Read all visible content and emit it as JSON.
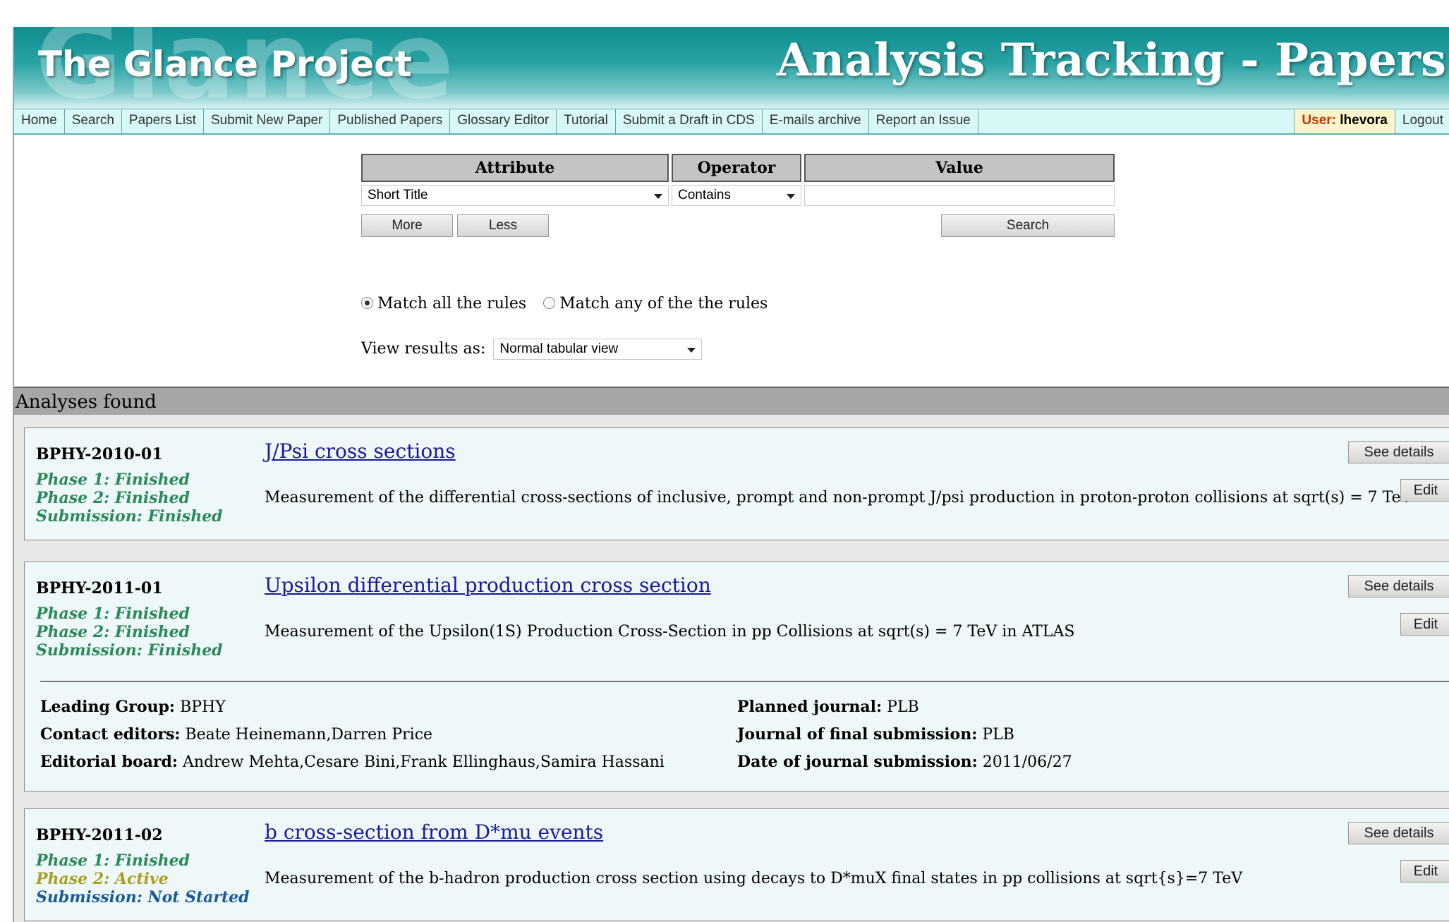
{
  "header": {
    "logo_watermark": "Glance",
    "logo": "The Glance Project",
    "title": "Analysis Tracking - Papers"
  },
  "nav": {
    "items": [
      "Home",
      "Search",
      "Papers List",
      "Submit New Paper",
      "Published Papers",
      "Glossary Editor",
      "Tutorial",
      "Submit a Draft in CDS",
      "E-mails archive",
      "Report an Issue"
    ],
    "user_label": "User:",
    "user_name": "lhevora",
    "logout": "Logout"
  },
  "search": {
    "headers": {
      "attribute": "Attribute",
      "operator": "Operator",
      "value": "Value"
    },
    "attribute_selected": "Short Title",
    "operator_selected": "Contains",
    "value": "",
    "more_label": "More",
    "less_label": "Less",
    "search_label": "Search",
    "match_all_label": "Match all the rules",
    "match_any_label": "Match any of the the rules",
    "match_selected": "all",
    "view_label": "View results as:",
    "view_selected": "Normal tabular view"
  },
  "results": {
    "heading": "Analyses found",
    "see_details_label": "See details",
    "edit_label": "Edit",
    "items": [
      {
        "code": "BPHY-2010-01",
        "title": "J/Psi cross sections",
        "description": "Measurement of the differential cross-sections of inclusive, prompt and non-prompt J/psi production in proton-proton collisions at sqrt(s) = 7 TeV",
        "phases": [
          "Phase 1: Finished",
          "Phase 2: Finished",
          "Submission: Finished"
        ]
      },
      {
        "code": "BPHY-2011-01",
        "title": "Upsilon differential production cross section",
        "description": "Measurement of the Upsilon(1S) Production Cross-Section in pp Collisions at sqrt(s) = 7 TeV in ATLAS",
        "phases": [
          "Phase 1: Finished",
          "Phase 2: Finished",
          "Submission: Finished"
        ],
        "details": {
          "leading_group_label": "Leading Group:",
          "leading_group": "BPHY",
          "contact_editors_label": "Contact editors:",
          "contact_editors": "Beate Heinemann,Darren Price",
          "editorial_board_label": "Editorial board:",
          "editorial_board": "Andrew Mehta,Cesare Bini,Frank Ellinghaus,Samira Hassani",
          "planned_journal_label": "Planned journal:",
          "planned_journal": "PLB",
          "final_journal_label": "Journal of final submission:",
          "final_journal": "PLB",
          "submission_date_label": "Date of journal submission:",
          "submission_date": "2011/06/27"
        }
      },
      {
        "code": "BPHY-2011-02",
        "title": "b cross-section from D*mu events",
        "description": "Measurement of the b-hadron production cross section using decays to D*muX final states in pp collisions at sqrt{s}=7 TeV",
        "phases": [
          "Phase 1: Finished",
          "Phase 2: Active",
          "Submission: Not Started"
        ]
      }
    ]
  }
}
